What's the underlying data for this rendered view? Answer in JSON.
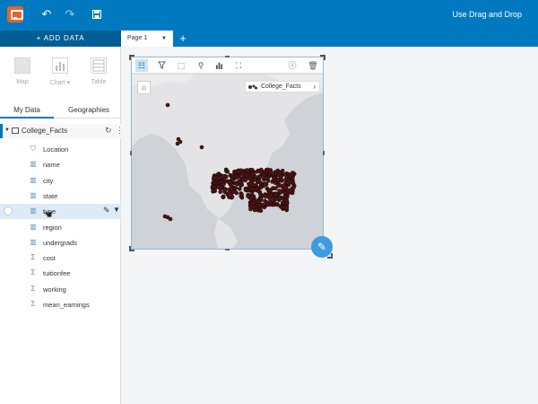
{
  "app": {
    "title": "Use Drag and Drop",
    "toolbar_icons": [
      "insights-logo",
      "undo-icon",
      "redo-icon",
      "save-icon"
    ]
  },
  "add_data": {
    "label": "+  ADD DATA"
  },
  "pages": {
    "tab_label": "Page 1",
    "add_icon": "+"
  },
  "viz_buttons": [
    {
      "label": "Map"
    },
    {
      "label": "Chart ▾"
    },
    {
      "label": "Table"
    }
  ],
  "panel_tabs": [
    "My Data",
    "Geographies"
  ],
  "dataset": {
    "name": "College_Facts",
    "fields": [
      {
        "name": "Location",
        "icon": "location-icon",
        "glyph": "⛉"
      },
      {
        "name": "name",
        "icon": "string-icon",
        "glyph": "▥"
      },
      {
        "name": "city",
        "icon": "string-icon",
        "glyph": "▥"
      },
      {
        "name": "state",
        "icon": "string-icon",
        "glyph": "▥"
      },
      {
        "name": "type",
        "icon": "string-icon",
        "glyph": "▥"
      },
      {
        "name": "region",
        "icon": "string-icon",
        "glyph": "▥"
      },
      {
        "name": "undergrads",
        "icon": "string-icon",
        "glyph": "▥"
      },
      {
        "name": "cost",
        "icon": "number-icon",
        "glyph": "Σ"
      },
      {
        "name": "tuitionfee",
        "icon": "number-icon",
        "glyph": "Σ"
      },
      {
        "name": "working",
        "icon": "number-icon",
        "glyph": "Σ"
      },
      {
        "name": "mean_earnings",
        "icon": "number-icon",
        "glyph": "Σ"
      }
    ]
  },
  "map_card": {
    "legend_label": "College_Facts",
    "tools": [
      "list-icon",
      "filter-icon",
      "select-icon",
      "zoom-icon",
      "chart-icon",
      "extent-icon",
      "info-icon",
      "delete-icon"
    ],
    "accent": "#0079c1",
    "point_color": "#5a1010"
  }
}
